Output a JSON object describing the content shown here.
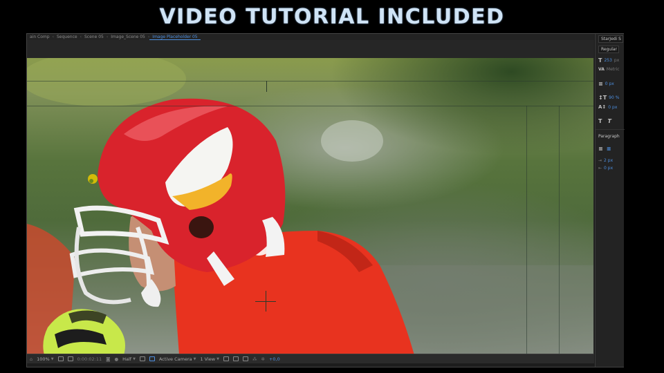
{
  "banner": {
    "title": "VIDEO TUTORIAL INCLUDED"
  },
  "breadcrumbs": [
    "ain Comp",
    "Sequence",
    "Scene 05",
    "Image_Scene 05",
    "Image Placeholder 05"
  ],
  "toolbar": {
    "zoom": "100%",
    "timecode": "0:00:02:11",
    "resolution": "Half",
    "camera": "Active Camera",
    "views": "1 View",
    "exposure": "+0,0"
  },
  "character_panel": {
    "font_family": "StarJedi S",
    "font_style": "Regular",
    "font_size": "253",
    "font_size_unit": "px",
    "kerning": "Metric",
    "stroke_width": "0 px",
    "vertical_scale": "90 %",
    "baseline_shift": "0 px",
    "paragraph_label": "Paragraph",
    "indent": "2 px",
    "space_before": "0 px"
  },
  "colors": {
    "accent": "#4d8fe0",
    "helmet": "#d9232c",
    "jersey": "#e8321f",
    "glove": "#c8e84a"
  }
}
